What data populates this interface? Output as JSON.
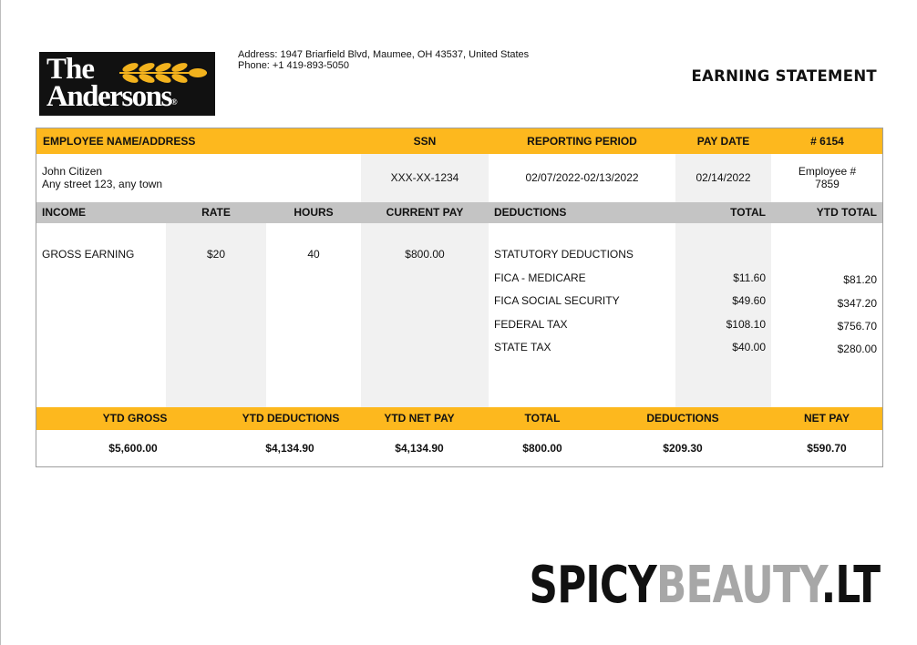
{
  "company": {
    "logo_line1": "The",
    "logo_line2": "Andersons",
    "logo_mark": "®",
    "address": "Address: 1947 Briarfield Blvd, Maumee, OH 43537, United States",
    "phone": "Phone: +1 419-893-5050"
  },
  "title": "EARNING STATEMENT",
  "header": {
    "employee_label": "EMPLOYEE NAME/ADDRESS",
    "ssn_label": "SSN",
    "period_label": "REPORTING PERIOD",
    "paydate_label": "PAY DATE",
    "number_label": "# 6154"
  },
  "employee": {
    "name": "John Citizen",
    "address": "Any street 123, any town",
    "ssn": "XXX-XX-1234",
    "period": "02/07/2022-02/13/2022",
    "pay_date": "02/14/2022",
    "id_label": "Employee #",
    "id": "7859"
  },
  "columns": {
    "income": "INCOME",
    "rate": "RATE",
    "hours": "HOURS",
    "current_pay": "CURRENT PAY",
    "deductions": "DEDUCTIONS",
    "total": "TOTAL",
    "ytd_total": "YTD TOTAL"
  },
  "income": {
    "label": "GROSS EARNING",
    "rate": "$20",
    "hours": "40",
    "current_pay": "$800.00"
  },
  "deductions_header": "STATUTORY DEDUCTIONS",
  "deductions": [
    {
      "name": "FICA - MEDICARE",
      "total": "$11.60",
      "ytd": "$81.20"
    },
    {
      "name": "FICA SOCIAL SECURITY",
      "total": "$49.60",
      "ytd": "$347.20"
    },
    {
      "name": "FEDERAL TAX",
      "total": "$108.10",
      "ytd": "$756.70"
    },
    {
      "name": "STATE TAX",
      "total": "$40.00",
      "ytd": "$280.00"
    }
  ],
  "summary_labels": {
    "ytd_gross": "YTD GROSS",
    "ytd_deductions": "YTD DEDUCTIONS",
    "ytd_net_pay": "YTD NET PAY",
    "total": "TOTAL",
    "deductions": "DEDUCTIONS",
    "net_pay": "NET PAY"
  },
  "summary_values": {
    "ytd_gross": "$5,600.00",
    "ytd_deductions": "$4,134.90",
    "ytd_net_pay": "$4,134.90",
    "total": "$800.00",
    "deductions": "$209.30",
    "net_pay": "$590.70"
  },
  "watermark": {
    "part1": "SPICY",
    "part2": "BEAUTY",
    "part3": ".LT"
  },
  "colors": {
    "accent_yellow": "#fdb81e",
    "header_grey": "#c4c4c4",
    "shade_grey": "#f1f1f1"
  }
}
